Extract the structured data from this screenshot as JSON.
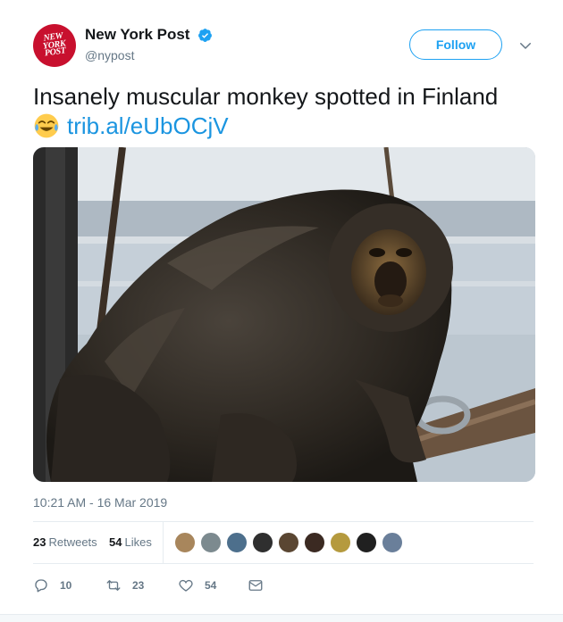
{
  "account": {
    "display_name": "New York Post",
    "handle": "@nypost",
    "verified": true,
    "avatar_logo_lines": [
      "NEW",
      "YORK",
      "POST"
    ],
    "avatar_color": "#c8102e"
  },
  "header": {
    "follow_label": "Follow",
    "menu_icon": "chevron-down-icon"
  },
  "tweet": {
    "text": "Insanely muscular monkey spotted in Finland",
    "emoji": "face-with-tears-of-joy",
    "link": "trib.al/eUbOCjV",
    "image": "muscular-monkey-photo"
  },
  "meta": {
    "timestamp": "10:21 AM - 16 Mar 2019"
  },
  "stats": {
    "retweets_count": "23",
    "retweets_label": "Retweets",
    "likes_count": "54",
    "likes_label": "Likes",
    "liker_avatars": 9
  },
  "actions": {
    "replies": "10",
    "retweets": "23",
    "likes": "54",
    "reply_icon": "reply-icon",
    "retweet_icon": "retweet-icon",
    "like_icon": "heart-icon",
    "dm_icon": "envelope-icon"
  },
  "colors": {
    "accent": "#1da1f2",
    "link": "#1b95e0",
    "muted": "#657786",
    "text": "#14171a",
    "border": "#e6ecf0"
  }
}
